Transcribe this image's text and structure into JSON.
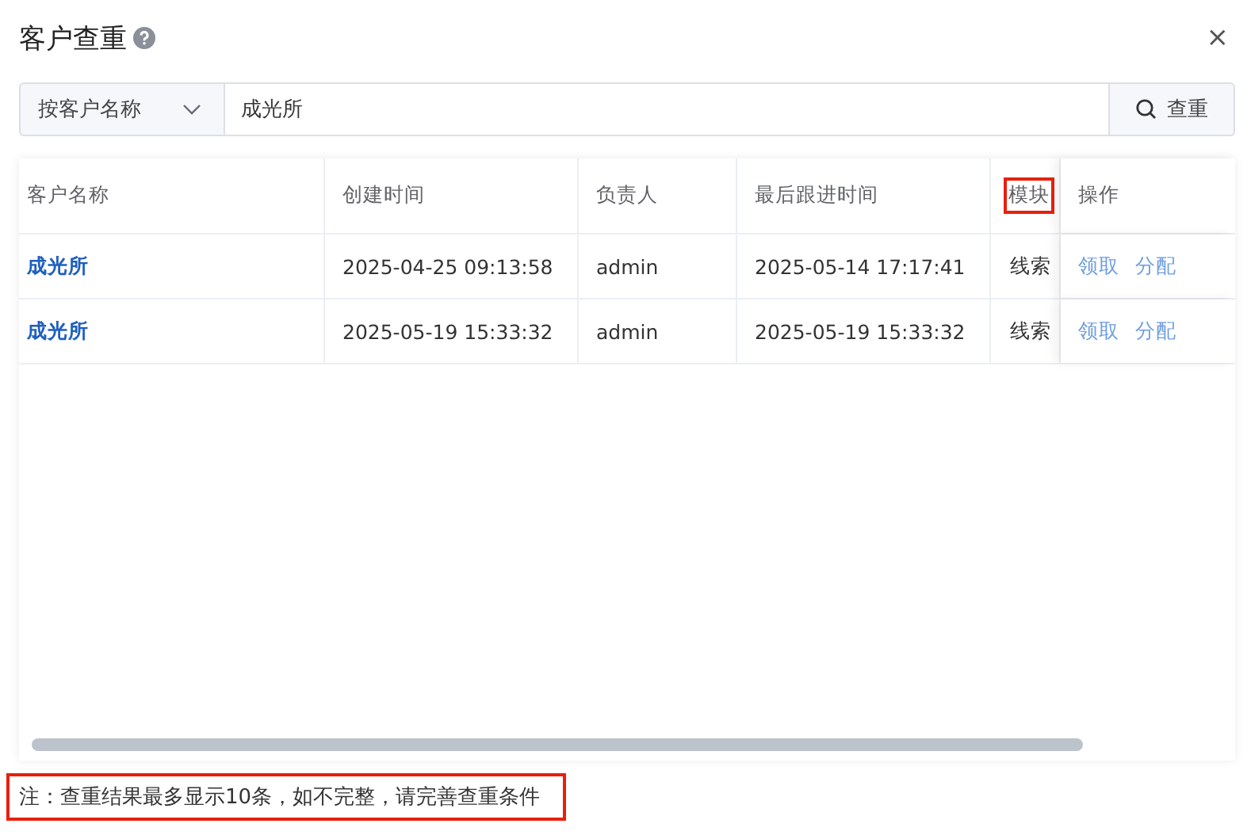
{
  "dialog": {
    "title": "客户查重",
    "close": "×"
  },
  "search": {
    "mode": "按客户名称",
    "value": "成光所",
    "button": "查重"
  },
  "table": {
    "columns": [
      {
        "label": "客户名称",
        "highlighted": false
      },
      {
        "label": "创建时间",
        "highlighted": false
      },
      {
        "label": "负责人",
        "highlighted": false
      },
      {
        "label": "最后跟进时间",
        "highlighted": false
      },
      {
        "label": "模块",
        "highlighted": true
      },
      {
        "label": "操作",
        "highlighted": false
      }
    ],
    "rows": [
      {
        "name": "成光所",
        "created": "2025-04-25 09:13:58",
        "owner": "admin",
        "last_follow": "2025-05-14 17:17:41",
        "module": "线索",
        "actions": [
          "领取",
          "分配"
        ]
      },
      {
        "name": "成光所",
        "created": "2025-05-19 15:33:32",
        "owner": "admin",
        "last_follow": "2025-05-19 15:33:32",
        "module": "线索",
        "actions": [
          "领取",
          "分配"
        ]
      }
    ]
  },
  "note": {
    "text": "注：查重结果最多显示10条，如不完整，请完善查重条件",
    "highlighted": true
  }
}
